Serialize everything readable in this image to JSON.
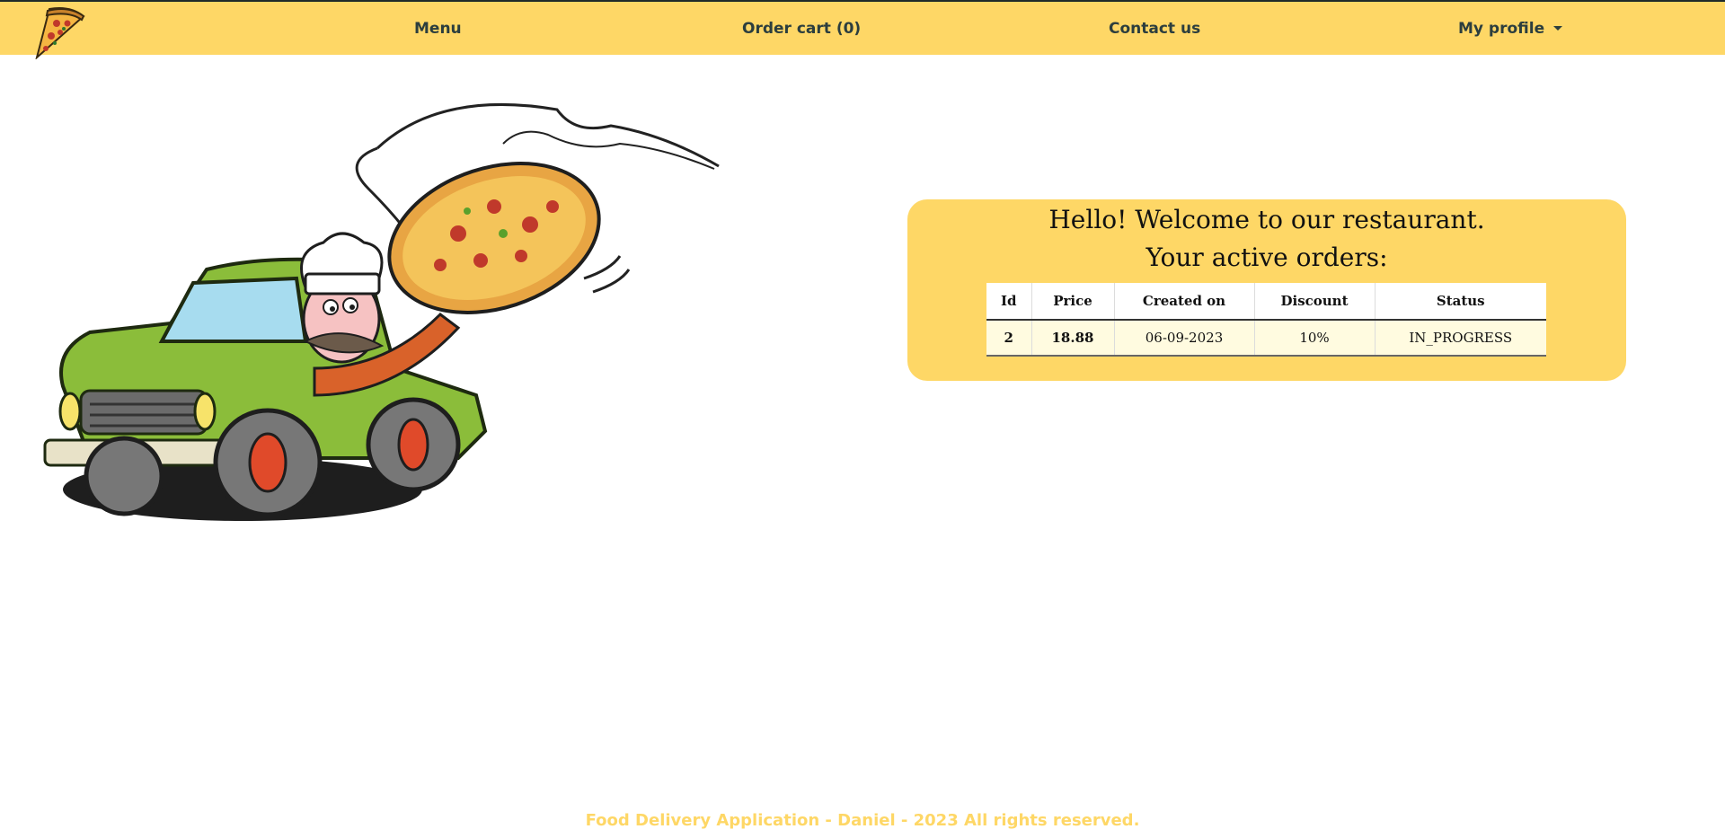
{
  "nav": {
    "menu": "Menu",
    "cart": "Order cart (0)",
    "contact": "Contact us",
    "profile": "My profile"
  },
  "welcome": {
    "greeting": "Hello! Welcome to our restaurant.",
    "orders_title": "Your active orders:"
  },
  "orders": {
    "headers": [
      "Id",
      "Price",
      "Created on",
      "Discount",
      "Status"
    ],
    "rows": [
      [
        "2",
        "18.88",
        "06-09-2023",
        "10%",
        "IN_PROGRESS"
      ]
    ]
  },
  "footer": "Food Delivery Application - Daniel - 2023 All rights reserved.",
  "colors": {
    "brand_yellow": "#fed766",
    "row_bg": "#fffbe0"
  },
  "icons": {
    "logo": "pizza-slice-icon",
    "profile_toggle": "caret-down-icon"
  }
}
